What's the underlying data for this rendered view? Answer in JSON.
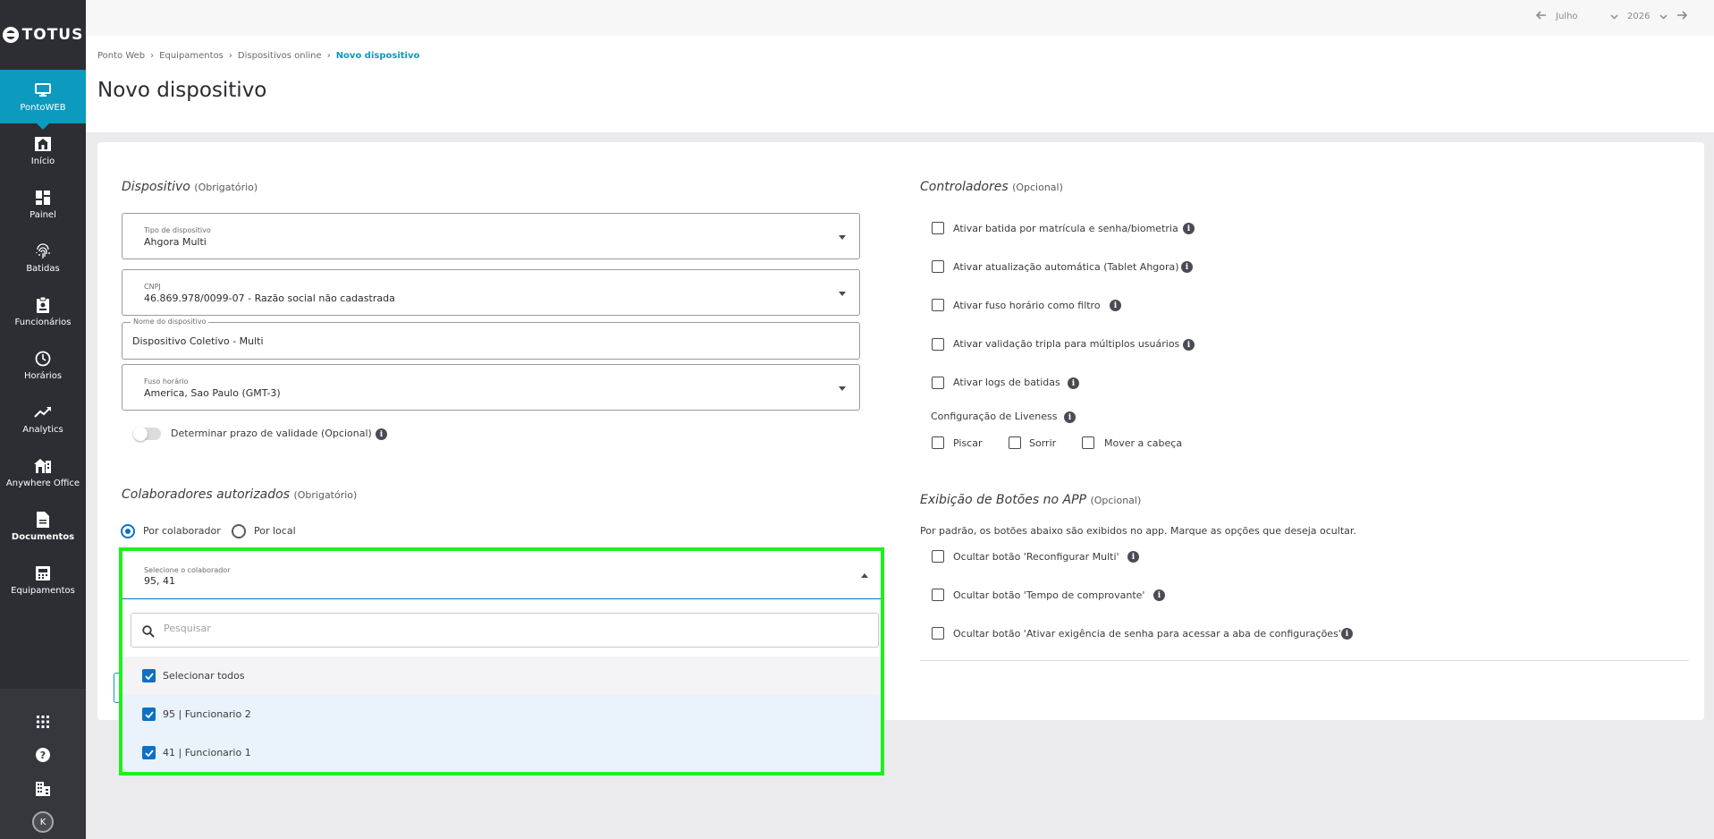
{
  "brand": {
    "name": "TOTUS"
  },
  "sidebar": {
    "items": [
      {
        "label": "PontoWEB",
        "icon": "monitor-icon"
      },
      {
        "label": "Início",
        "icon": "home-icon"
      },
      {
        "label": "Painel",
        "icon": "dashboard-icon"
      },
      {
        "label": "Batidas",
        "icon": "fingerprint-icon"
      },
      {
        "label": "Funcionários",
        "icon": "badge-icon"
      },
      {
        "label": "Horários",
        "icon": "clock-icon"
      },
      {
        "label": "Analytics",
        "icon": "trend-icon"
      },
      {
        "label": "Anywhere Office",
        "icon": "house-office-icon"
      },
      {
        "label": "Documentos",
        "icon": "document-icon"
      },
      {
        "label": "Equipamentos",
        "icon": "device-icon"
      }
    ],
    "bottom": {
      "avatar_initial": "K"
    }
  },
  "topbar": {
    "month": "Julho",
    "year": "2026"
  },
  "breadcrumb": [
    "Ponto Web",
    "Equipamentos",
    "Dispositivos online",
    "Novo dispositivo"
  ],
  "page": {
    "title": "Novo dispositivo"
  },
  "dispositivo": {
    "title": "Dispositivo",
    "optional": "(Obrigatório)",
    "tipo": {
      "label": "Tipo de dispositivo",
      "value": "Ahgora Multi"
    },
    "cnpj": {
      "label": "CNPJ",
      "value": "46.869.978/0099-07 - Razão social não cadastrada"
    },
    "nome": {
      "label": "Nome do dispositivo",
      "value": "Dispositivo Coletivo - Multi"
    },
    "fuso": {
      "label": "Fuso horário",
      "value": "America, Sao Paulo (GMT-3)"
    },
    "validade_label": "Determinar prazo de validade (Opcional)"
  },
  "colaboradores": {
    "title": "Colaboradores autorizados",
    "optional": "(Obrigatório)",
    "radio_colaborador": "Por colaborador",
    "radio_local": "Por local",
    "select": {
      "label": "Selecione o colaborador",
      "value": "95, 41",
      "search_placeholder": "Pesquisar",
      "options": [
        "Selecionar todos",
        "95 | Funcionario 2",
        "41 | Funcionario 1"
      ]
    }
  },
  "controladores": {
    "title": "Controladores",
    "optional": "(Opcional)",
    "options": [
      "Ativar batida por matrícula e senha/biometria",
      "Ativar atualização automática (Tablet Ahgora)",
      "Ativar fuso horário como filtro",
      "Ativar validação tripla para múltiplos usuários",
      "Ativar logs de batidas"
    ],
    "liveness_label": "Configuração de Liveness",
    "liveness": [
      "Piscar",
      "Sorrir",
      "Mover a cabeça"
    ]
  },
  "botoes": {
    "title": "Exibição de Botões no APP",
    "optional": "(Opcional)",
    "description": "Por padrão, os botões abaixo são exibidos no app. Marque as opções que deseja ocultar.",
    "options": [
      "Ocultar botão 'Reconfigurar Multi'",
      "Ocultar botão 'Tempo de comprovante'",
      "Ocultar botão 'Ativar exigência de senha para acessar a aba de configurações'"
    ]
  },
  "colors": {
    "accent": "#0c9abe",
    "primary": "#0c71c3",
    "sidebar": "#2c2e33",
    "highlight": "#1df01d"
  }
}
